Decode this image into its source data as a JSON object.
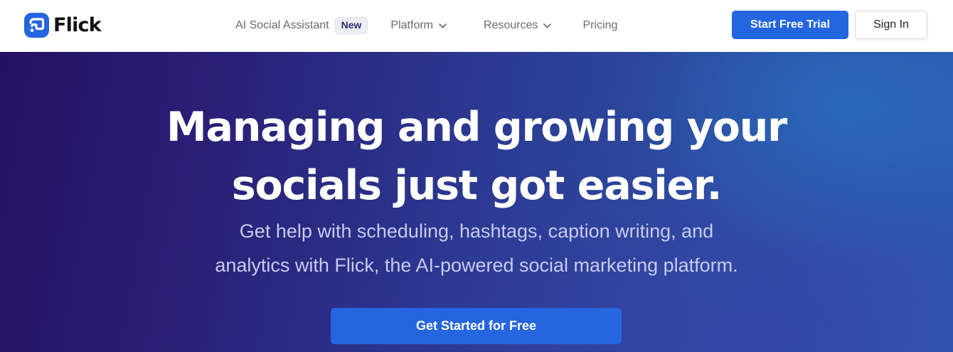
{
  "brand": {
    "name": "Flick",
    "logo_icon": "flick-logo-icon",
    "accent_color": "#2466E0"
  },
  "nav": {
    "items": [
      {
        "label": "AI Social Assistant",
        "badge": "New"
      },
      {
        "label": "Platform",
        "icon": "chevron-down-icon"
      },
      {
        "label": "Resources",
        "icon": "chevron-down-icon"
      },
      {
        "label": "Pricing"
      }
    ]
  },
  "header": {
    "trial_button": "Start Free Trial",
    "signin_button": "Sign In"
  },
  "hero": {
    "title_line1": "Managing and growing your",
    "title_line2": "socials just got easier.",
    "subtitle_line1": "Get help with scheduling, hashtags, caption writing, and",
    "subtitle_line2": "analytics with Flick, the AI-powered social marketing platform.",
    "cta_button": "Get Started for Free",
    "background_colors": [
      "#241164",
      "#2A5AAE"
    ]
  }
}
